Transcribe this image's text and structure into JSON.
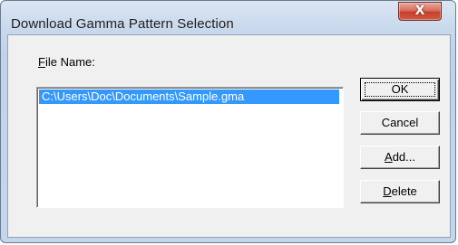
{
  "window": {
    "title": "Download Gamma Pattern Selection",
    "close_glyph": "X",
    "close_icon": "close-icon"
  },
  "file_name": {
    "label_mnemonic": "F",
    "label_rest": "ile Name:",
    "items": [
      "C:\\Users\\Doc\\Documents\\Sample.gma"
    ],
    "selected_index": 0
  },
  "buttons": {
    "ok": "OK",
    "cancel": "Cancel",
    "add_mnemonic": "A",
    "add_rest": "dd...",
    "delete_mnemonic": "D",
    "delete_rest": "elete"
  },
  "colors": {
    "selection": "#3399ff",
    "close_button": "#c5412c",
    "dialog_face": "#f0f0f0"
  }
}
